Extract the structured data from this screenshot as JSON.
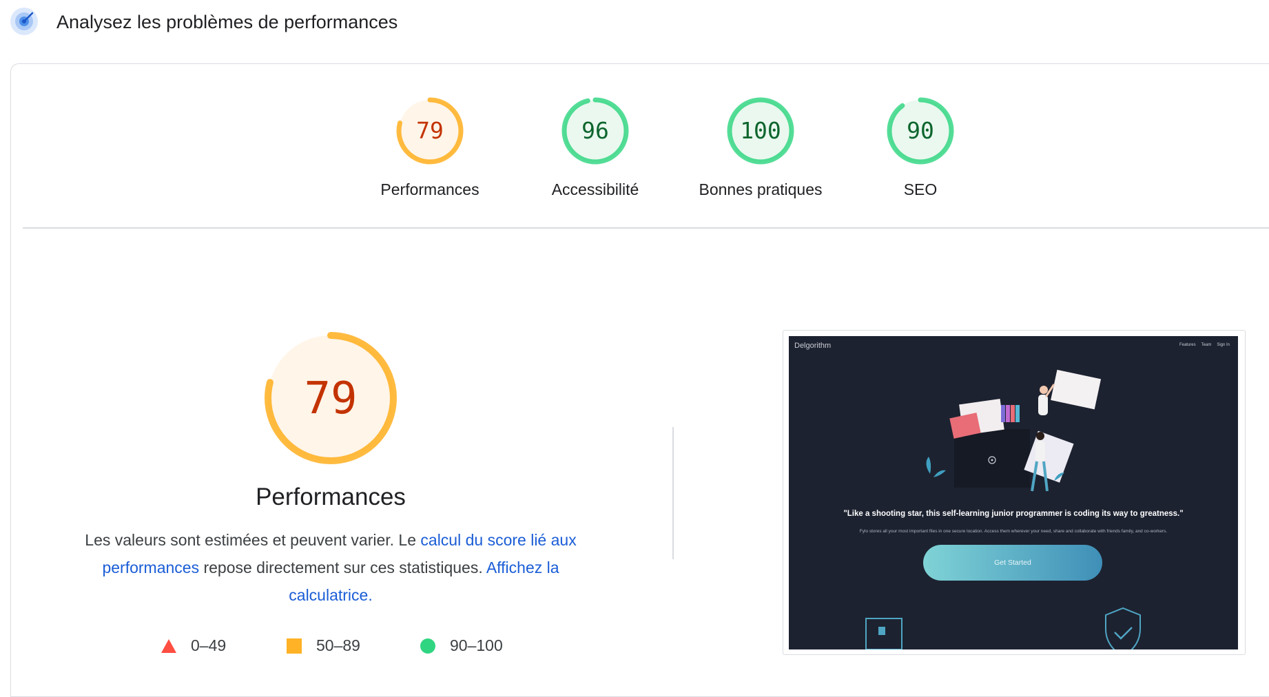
{
  "header": {
    "title": "Analysez les problèmes de performances",
    "icon": "lighthouse-gauge-icon"
  },
  "colors": {
    "pass": "#0cce6b",
    "pass_text": "#0d652d",
    "average": "#ffa400",
    "average_text": "#c33300",
    "fail": "#ff4e42",
    "link": "#1a5dd6"
  },
  "gauges": [
    {
      "score": "79",
      "label": "Performances",
      "value": 0.79,
      "rating": "average"
    },
    {
      "score": "96",
      "label": "Accessibilité",
      "value": 0.96,
      "rating": "pass"
    },
    {
      "score": "100",
      "label": "Bonnes pratiques",
      "value": 1.0,
      "rating": "pass"
    },
    {
      "score": "90",
      "label": "SEO",
      "value": 0.9,
      "rating": "pass"
    }
  ],
  "performance": {
    "score": "79",
    "value": 0.79,
    "title": "Performances",
    "description_prefix": "Les valeurs sont estimées et peuvent varier. Le ",
    "link1": "calcul du score lié aux performances",
    "description_middle": " repose directement sur ces statistiques. ",
    "link2": "Affichez la calculatrice."
  },
  "legend": [
    {
      "range": "0–49",
      "icon": "red-triangle-icon"
    },
    {
      "range": "50–89",
      "icon": "orange-square-icon"
    },
    {
      "range": "90–100",
      "icon": "green-circle-icon"
    }
  ],
  "thumbnail": {
    "brand": "Delgorithm",
    "nav": [
      "Features",
      "Team",
      "Sign In"
    ],
    "quote": "\"Like a shooting star, this self-learning junior programmer is coding its way to greatness.\"",
    "subtitle": "Fylo stores all your most important files in one secure location. Access them wherever your need, share and collaborate with friends family, and co-workers.",
    "cta": "Get Started"
  }
}
